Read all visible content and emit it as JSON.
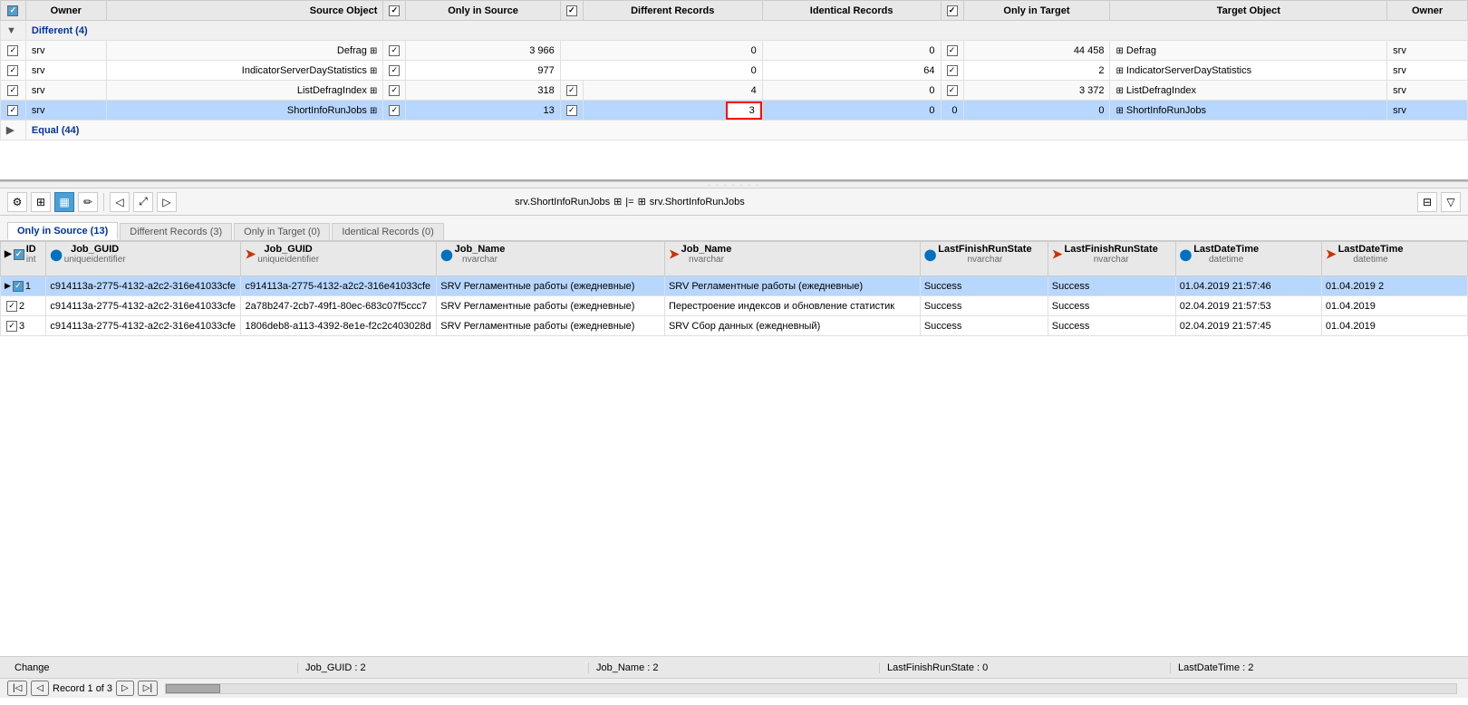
{
  "header": {
    "columns": [
      "Owner",
      "Source Object",
      "Only in Source",
      "Different Records",
      "Identical Records",
      "Only in Target",
      "Target Object",
      "Owner"
    ]
  },
  "top_table": {
    "group_different": {
      "label": "Different (4)",
      "expanded": true,
      "rows": [
        {
          "owner": "srv",
          "source_object": "Defrag",
          "only_in_source": "3 966",
          "different_records": "0",
          "identical_records": "0",
          "only_in_target": "44 458",
          "target_object": "Defrag",
          "target_owner": "srv",
          "has_checkbox": true,
          "checked": true,
          "highlight": false
        },
        {
          "owner": "srv",
          "source_object": "IndicatorServerDayStatistics",
          "only_in_source": "977",
          "different_records": "0",
          "identical_records": "64",
          "only_in_target": "2",
          "target_object": "IndicatorServerDayStatistics",
          "target_owner": "srv",
          "has_checkbox": true,
          "checked": true,
          "highlight": false
        },
        {
          "owner": "srv",
          "source_object": "ListDefragIndex",
          "only_in_source": "318",
          "different_records": "4",
          "identical_records": "0",
          "only_in_target": "3 372",
          "target_object": "ListDefragIndex",
          "target_owner": "srv",
          "has_checkbox": true,
          "checked": true,
          "highlight": false
        },
        {
          "owner": "srv",
          "source_object": "ShortInfoRunJobs",
          "only_in_source": "13",
          "different_records": "3",
          "identical_records": "0",
          "only_in_target": "0",
          "target_object": "ShortInfoRunJobs",
          "target_owner": "srv",
          "has_checkbox": true,
          "checked": true,
          "highlight": true
        }
      ]
    },
    "group_equal": {
      "label": "Equal (44)",
      "expanded": false
    }
  },
  "detail": {
    "title_left": "srv.ShortInfoRunJobs",
    "title_right": "srv.ShortInfoRunJobs",
    "tabs": [
      {
        "label": "Only in Source (13)",
        "active": true
      },
      {
        "label": "Different Records (3)",
        "active": false
      },
      {
        "label": "Only in Target (0)",
        "active": false
      },
      {
        "label": "Identical Records (0)",
        "active": false
      }
    ],
    "columns": [
      {
        "name": "ID",
        "type": "int",
        "kind": "id"
      },
      {
        "name": "Job_GUID",
        "type": "uniqueidentifier",
        "kind": "source"
      },
      {
        "name": "Job_GUID",
        "type": "uniqueidentifier",
        "kind": "target"
      },
      {
        "name": "Job_Name",
        "type": "nvarchar",
        "kind": "source"
      },
      {
        "name": "Job_Name",
        "type": "nvarchar",
        "kind": "target"
      },
      {
        "name": "LastFinishRunState",
        "type": "nvarchar",
        "kind": "source"
      },
      {
        "name": "LastFinishRunState",
        "type": "nvarchar",
        "kind": "target"
      },
      {
        "name": "LastDateTime",
        "type": "datetime",
        "kind": "source"
      },
      {
        "name": "LastDateTime",
        "type": "datetime",
        "kind": "target"
      }
    ],
    "rows": [
      {
        "id": 1,
        "job_guid_src": "c914113a-2775-4132-a2c2-316e41033cfe",
        "job_guid_tgt": "c914113a-2775-4132-a2c2-316e41033cfe",
        "job_name_src": "SRV Регламентные работы (ежедневные)",
        "job_name_tgt": "SRV Регламентные работы (ежедневные)",
        "state_src": "Success",
        "state_tgt": "Success",
        "dt_src": "01.04.2019 21:57:46",
        "dt_tgt": "01.04.2019 2",
        "selected": true,
        "active": true
      },
      {
        "id": 2,
        "job_guid_src": "c914113a-2775-4132-a2c2-316e41033cfe",
        "job_guid_tgt": "2a78b247-2cb7-49f1-80ec-683c07f5ccc7",
        "job_name_src": "SRV Регламентные работы (ежедневные)",
        "job_name_tgt": "Перестроение индексов и обновление статистик",
        "state_src": "Success",
        "state_tgt": "Success",
        "dt_src": "02.04.2019 21:57:53",
        "dt_tgt": "01.04.2019",
        "selected": false,
        "active": false
      },
      {
        "id": 3,
        "job_guid_src": "c914113a-2775-4132-a2c2-316e41033cfe",
        "job_guid_tgt": "1806deb8-a113-4392-8e1e-f2c2c403028d",
        "job_name_src": "SRV Регламентные работы (ежедневные)",
        "job_name_tgt": "SRV Сбор данных (ежедневный)",
        "state_src": "Success",
        "state_tgt": "Success",
        "dt_src": "02.04.2019 21:57:45",
        "dt_tgt": "01.04.2019",
        "selected": false,
        "active": false
      }
    ]
  },
  "status_bar": {
    "section1": "Change",
    "section2": "Job_GUID : 2",
    "section3": "Job_Name : 2",
    "section4": "LastFinishRunState : 0",
    "section5": "LastDateTime : 2"
  },
  "nav_bar": {
    "record_info": "Record 1 of 3"
  }
}
